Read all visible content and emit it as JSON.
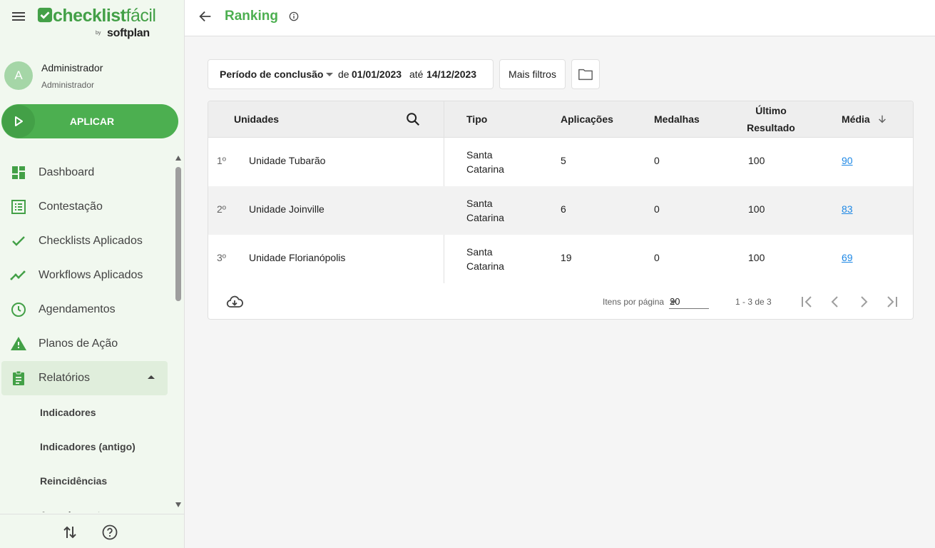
{
  "app": {
    "logo_main": "checklist",
    "logo_main_thin": "fácil",
    "logo_by": "by",
    "logo_sub": "softplan"
  },
  "user": {
    "initial": "A",
    "name": "Administrador",
    "role": "Administrador"
  },
  "sidebar": {
    "apply_label": "APLICAR",
    "items": [
      {
        "label": "Dashboard",
        "icon": "dashboard-icon"
      },
      {
        "label": "Contestação",
        "icon": "list-icon"
      },
      {
        "label": "Checklists Aplicados",
        "icon": "check-icon"
      },
      {
        "label": "Workflows Aplicados",
        "icon": "trending-icon"
      },
      {
        "label": "Agendamentos",
        "icon": "clock-icon"
      },
      {
        "label": "Planos de Ação",
        "icon": "warning-icon"
      },
      {
        "label": "Relatórios",
        "icon": "clipboard-icon"
      }
    ],
    "sub_items": [
      {
        "label": "Indicadores"
      },
      {
        "label": "Indicadores (antigo)"
      },
      {
        "label": "Reincidências"
      },
      {
        "label": "Agendamentos"
      }
    ]
  },
  "header": {
    "title": "Ranking"
  },
  "filters": {
    "period_label": "Período de conclusão",
    "de": "de",
    "start": "01/01/2023",
    "ate": "até",
    "end": "14/12/2023",
    "more": "Mais filtros"
  },
  "table": {
    "headers": {
      "unidades": "Unidades",
      "tipo": "Tipo",
      "aplicacoes": "Aplicações",
      "medalhas": "Medalhas",
      "ultimo_1": "Último",
      "ultimo_2": "Resultado",
      "media": "Média"
    },
    "rows": [
      {
        "rank": "1º",
        "unit": "Unidade Tubarão",
        "tipo_1": "Santa",
        "tipo_2": "Catarina",
        "aplicacoes": "5",
        "medalhas": "0",
        "ultimo": "100",
        "media": "90"
      },
      {
        "rank": "2º",
        "unit": "Unidade Joinville",
        "tipo_1": "Santa",
        "tipo_2": "Catarina",
        "aplicacoes": "6",
        "medalhas": "0",
        "ultimo": "100",
        "media": "83"
      },
      {
        "rank": "3º",
        "unit": "Unidade Florianópolis",
        "tipo_1": "Santa",
        "tipo_2": "Catarina",
        "aplicacoes": "19",
        "medalhas": "0",
        "ultimo": "100",
        "media": "69"
      }
    ],
    "footer": {
      "items_per_page_label": "Itens por página",
      "items_per_page": "20",
      "range": "1 - 3 de 3"
    }
  },
  "colors": {
    "brand": "#4caf50",
    "link": "#1e88e5"
  }
}
